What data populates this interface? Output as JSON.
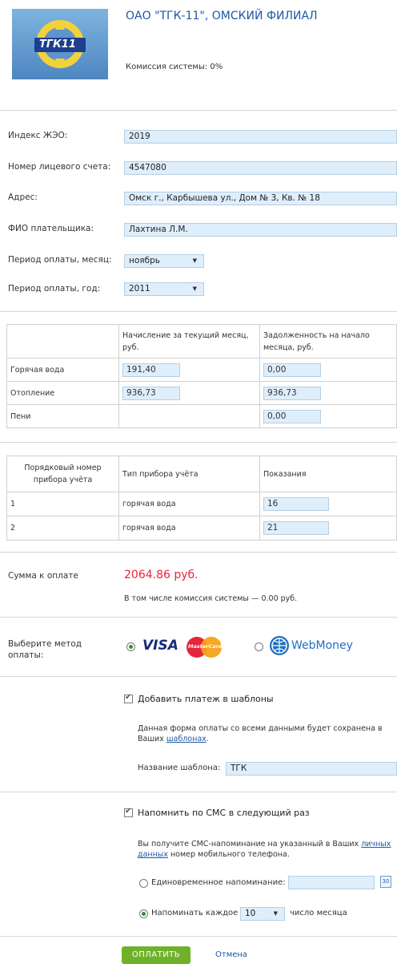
{
  "header": {
    "logo_text": "ТГК11",
    "title": "ОАО \"ТГК-11\", ОМСКИЙ ФИЛИАЛ",
    "commission": "Комиссия системы: 0%"
  },
  "form": {
    "zheo_label": "Индекс ЖЭО:",
    "zheo_value": "2019",
    "account_label": "Номер лицевого счета:",
    "account_value": "4547080",
    "address_label": "Адрес:",
    "address_value": "Омск г., Карбышева ул., Дом № 3, Кв. № 18",
    "payer_label": "ФИО плательщика:",
    "payer_value": "Лахтина Л.М.",
    "month_label": "Период оплаты, месяц:",
    "month_value": "ноябрь",
    "year_label": "Период оплаты, год:",
    "year_value": "2011"
  },
  "charges": {
    "headers": [
      "Начисление за текущий месяц, руб.",
      "Задолженность на начало месяца, руб."
    ],
    "rows": [
      {
        "name": "Горячая вода",
        "current": "191,40",
        "debt": "0,00"
      },
      {
        "name": "Отопление",
        "current": "936,73",
        "debt": "936,73"
      },
      {
        "name": "Пени",
        "current": "",
        "debt": "0,00"
      }
    ]
  },
  "meters": {
    "headers": [
      "Порядковый номер прибора учёта",
      "Тип прибора учёта",
      "Показания"
    ],
    "rows": [
      {
        "num": "1",
        "type": "горячая вода",
        "reading": "16"
      },
      {
        "num": "2",
        "type": "горячая вода",
        "reading": "21"
      }
    ]
  },
  "sum": {
    "label": "Сумма к оплате",
    "value": "2064.86 руб.",
    "commission_note": "В том числе комиссия системы — 0.00 руб."
  },
  "payment": {
    "label": "Выберите метод оплаты:",
    "visa_text": "VISA",
    "mastercard_text": "MasterCard",
    "webmoney_text": "WebMoney"
  },
  "template": {
    "checkbox_label": "Добавить платеж в шаблоны",
    "note_part1": "Данная форма оплаты со всеми данными будет сохранена в Ваших ",
    "note_link": "шаблонах",
    "note_part2": ".",
    "name_label": "Название шаблона:",
    "name_value": "ТГК"
  },
  "sms": {
    "checkbox_label": "Напомнить по СМС в следующий раз",
    "note_part1": "Вы получите СМС-напоминание на указанный в Ваших ",
    "note_link": "личных данных",
    "note_part2": " номер мобильного телефона.",
    "once_label": "Единовременное напоминание:",
    "calendar_day": "30",
    "every_label": "Напоминать каждое",
    "every_value": "10",
    "every_suffix": "число месяца"
  },
  "actions": {
    "pay_label": "ОПЛАТИТЬ",
    "cancel_label": "Отмена"
  },
  "colors": {
    "accent_red": "#e8243c",
    "pay_button": "#6fb22a",
    "field_bg": "#dfeefb"
  }
}
